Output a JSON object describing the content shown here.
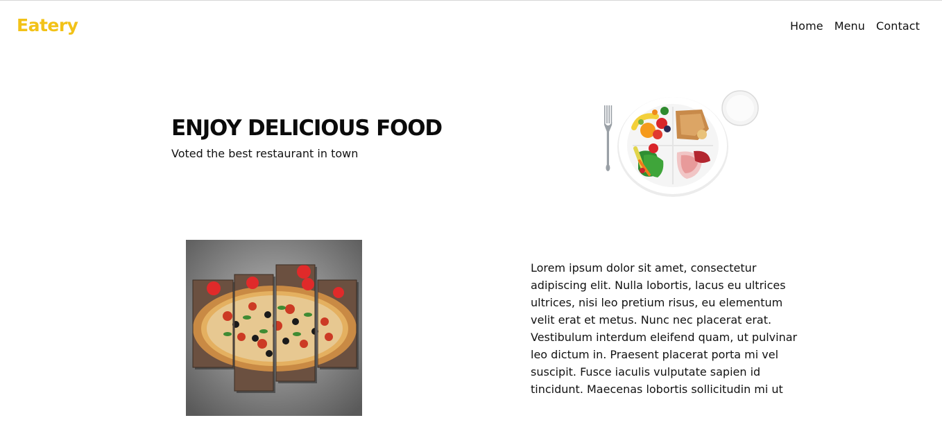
{
  "header": {
    "logo": "Eatery",
    "nav": [
      {
        "label": "Home"
      },
      {
        "label": "Menu"
      },
      {
        "label": "Contact"
      }
    ]
  },
  "hero": {
    "title": "ENJOY DELICIOUS FOOD",
    "subtitle": "Voted the best restaurant in town",
    "image_icon": "food-plate-illustration"
  },
  "about": {
    "image_icon": "pizza-canvas-illustration",
    "text": "Lorem ipsum dolor sit amet, consectetur adipiscing elit. Nulla lobortis, lacus eu ultrices ultrices, nisi leo pretium risus, eu elementum velit erat et metus. Nunc nec placerat erat. Vestibulum interdum eleifend quam, ut pulvinar leo dictum in. Praesent placerat porta mi vel suscipit. Fusce iaculis vulputate sapien id tincidunt. Maecenas lobortis sollicitudin mi ut"
  },
  "colors": {
    "brand": "#f2c218",
    "text": "#111111",
    "background": "#ffffff"
  }
}
